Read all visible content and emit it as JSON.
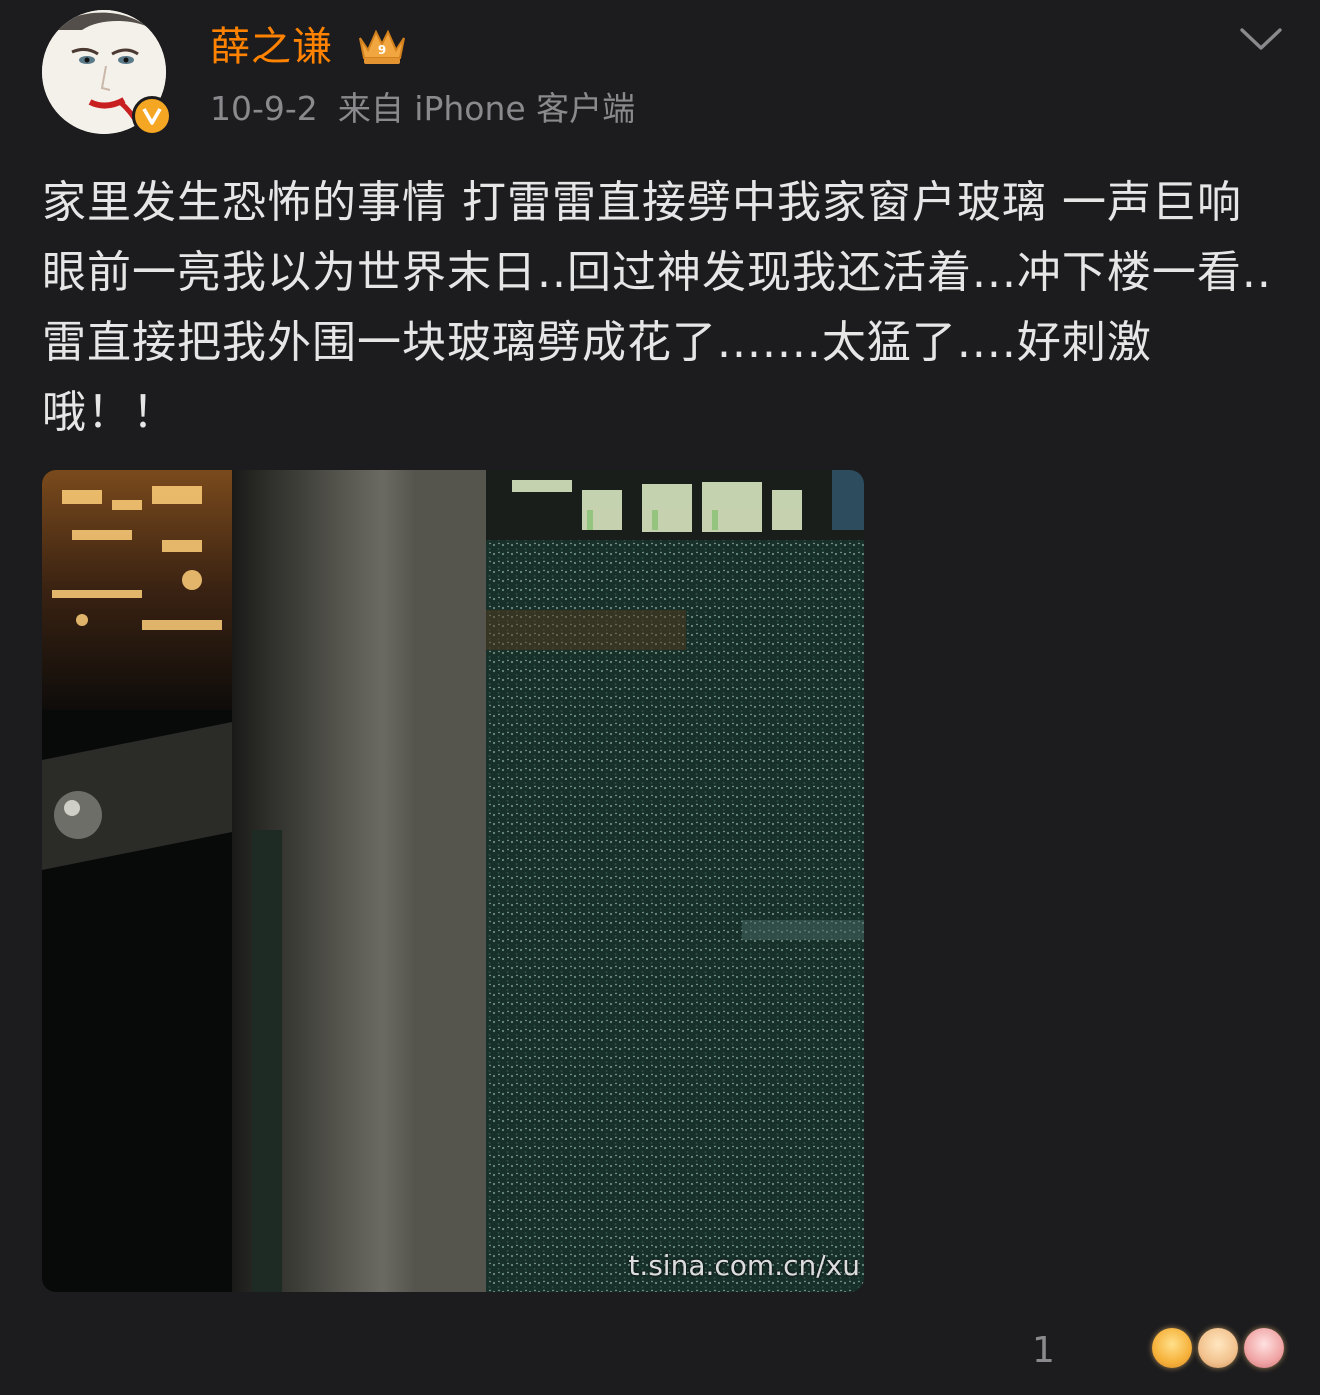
{
  "author": {
    "name": "薛之谦",
    "avatar_icon": "avatar-portrait",
    "verified_icon": "verified-v-icon",
    "vip_icon": "vip-crown-icon",
    "name_color": "#ff8200"
  },
  "meta": {
    "time": "10-9-2",
    "source": "来自 iPhone 客户端"
  },
  "post": {
    "text": "家里发生恐怖的事情 打雷雷直接劈中我家窗户玻璃 一声巨响眼前一亮我以为世界末日..回过神发现我还活着...冲下楼一看..雷直接把我外围一块玻璃劈成花了.......太猛了....好刺激哦！！",
    "image": {
      "description_icon": "photo-cracked-glass",
      "watermark": "t.sina.com.cn/xu"
    }
  },
  "footer": {
    "like_count": "1",
    "reaction_icons": [
      "emoji-face-icon",
      "emoji-face-icon",
      "emoji-face-icon"
    ]
  },
  "menu": {
    "icon": "chevron-down-icon"
  }
}
